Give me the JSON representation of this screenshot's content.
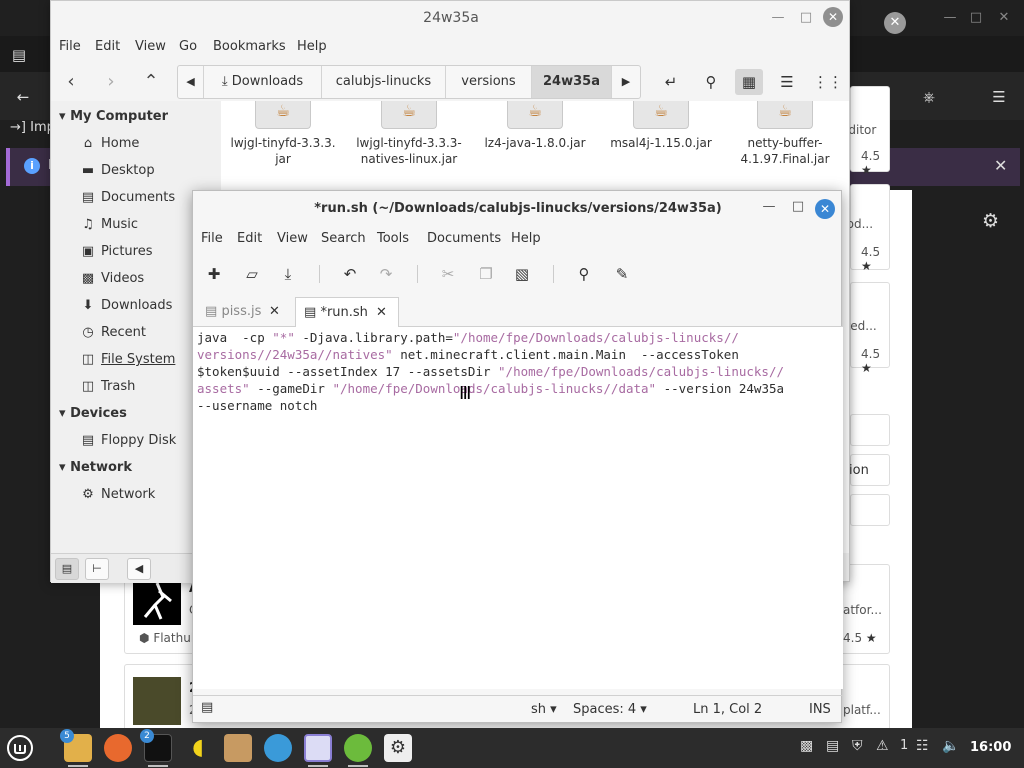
{
  "background_browser": {
    "import_label": "Imp",
    "notice_text": "F",
    "software_cards": [
      {
        "snippet": "editor",
        "rating": "4.5"
      },
      {
        "snippet": "nod...",
        "rating": "4.5"
      },
      {
        "snippet": "cted...",
        "rating": "4.5"
      },
      {
        "snippet": "ion"
      },
      {
        "title": "A",
        "snippet": "C",
        "snippet2": "atfor...",
        "source": "Flathub",
        "rating": "4.5"
      },
      {
        "title": "2",
        "snippet": "2",
        "snippet2": "platf..."
      }
    ]
  },
  "file_manager": {
    "title": "24w35a",
    "menu": [
      "File",
      "Edit",
      "View",
      "Go",
      "Bookmarks",
      "Help"
    ],
    "breadcrumbs": [
      "Downloads",
      "calubjs-linucks",
      "versions",
      "24w35a"
    ],
    "sidebar": {
      "sections": [
        {
          "heading": "My Computer",
          "items": [
            {
              "label": "Home",
              "icon": "home-icon"
            },
            {
              "label": "Desktop",
              "icon": "desktop-icon"
            },
            {
              "label": "Documents",
              "icon": "documents-icon"
            },
            {
              "label": "Music",
              "icon": "music-icon"
            },
            {
              "label": "Pictures",
              "icon": "pictures-icon"
            },
            {
              "label": "Videos",
              "icon": "videos-icon"
            },
            {
              "label": "Downloads",
              "icon": "downloads-icon"
            },
            {
              "label": "Recent",
              "icon": "recent-icon"
            },
            {
              "label": "File System",
              "icon": "filesystem-icon"
            },
            {
              "label": "Trash",
              "icon": "trash-icon"
            }
          ]
        },
        {
          "heading": "Devices",
          "items": [
            {
              "label": "Floppy Disk",
              "icon": "floppy-icon"
            }
          ]
        },
        {
          "heading": "Network",
          "items": [
            {
              "label": "Network",
              "icon": "network-icon"
            }
          ]
        }
      ]
    },
    "files": [
      {
        "line1": "lwjgl-tinyfd-3.3.3.",
        "line2": "jar"
      },
      {
        "line1": "lwjgl-tinyfd-3.3.3-",
        "line2": "natives-linux.jar"
      },
      {
        "line1": "lz4-java-1.8.0.jar",
        "line2": ""
      },
      {
        "line1": "msal4j-1.15.0.jar",
        "line2": ""
      },
      {
        "line1": "netty-buffer-",
        "line2": "4.1.97.Final.jar"
      }
    ]
  },
  "editor": {
    "title": "*run.sh (~/Downloads/calubjs-linucks/versions/24w35a)",
    "menu": [
      "File",
      "Edit",
      "View",
      "Search",
      "Tools",
      "Documents",
      "Help"
    ],
    "tabs": [
      {
        "label": "piss.js",
        "active": false
      },
      {
        "label": "*run.sh",
        "active": true
      }
    ],
    "code_lines": [
      [
        {
          "t": "java  -cp "
        },
        {
          "t": "\"*\"",
          "s": true
        },
        {
          "t": " -Djava.library.path="
        },
        {
          "t": "\"/home/fpe/Downloads/calubjs-linucks//",
          "s": true
        }
      ],
      [
        {
          "t": "versions//24w35a//natives\"",
          "s": true
        },
        {
          "t": " net.minecraft.client.main.Main  --accessToken"
        }
      ],
      [
        {
          "t": "$token$uuid --assetIndex 17 --assetsDir "
        },
        {
          "t": "\"/home/fpe/Downloads/calubjs-linucks//",
          "s": true
        }
      ],
      [
        {
          "t": "assets\"",
          "s": true
        },
        {
          "t": " --gameDir "
        },
        {
          "t": "\"/home/fpe/Downloads/calubjs-linucks//data\"",
          "s": true
        },
        {
          "t": " --version 24w35a"
        }
      ],
      [
        {
          "t": "--username notch"
        }
      ]
    ],
    "status": {
      "language": "sh",
      "spaces": "Spaces: 4",
      "position": "Ln 1, Col 2",
      "mode": "INS"
    }
  },
  "taskbar": {
    "badges": {
      "files": "5",
      "terminal": "2"
    },
    "tray_number": "1",
    "clock": "16:00"
  }
}
